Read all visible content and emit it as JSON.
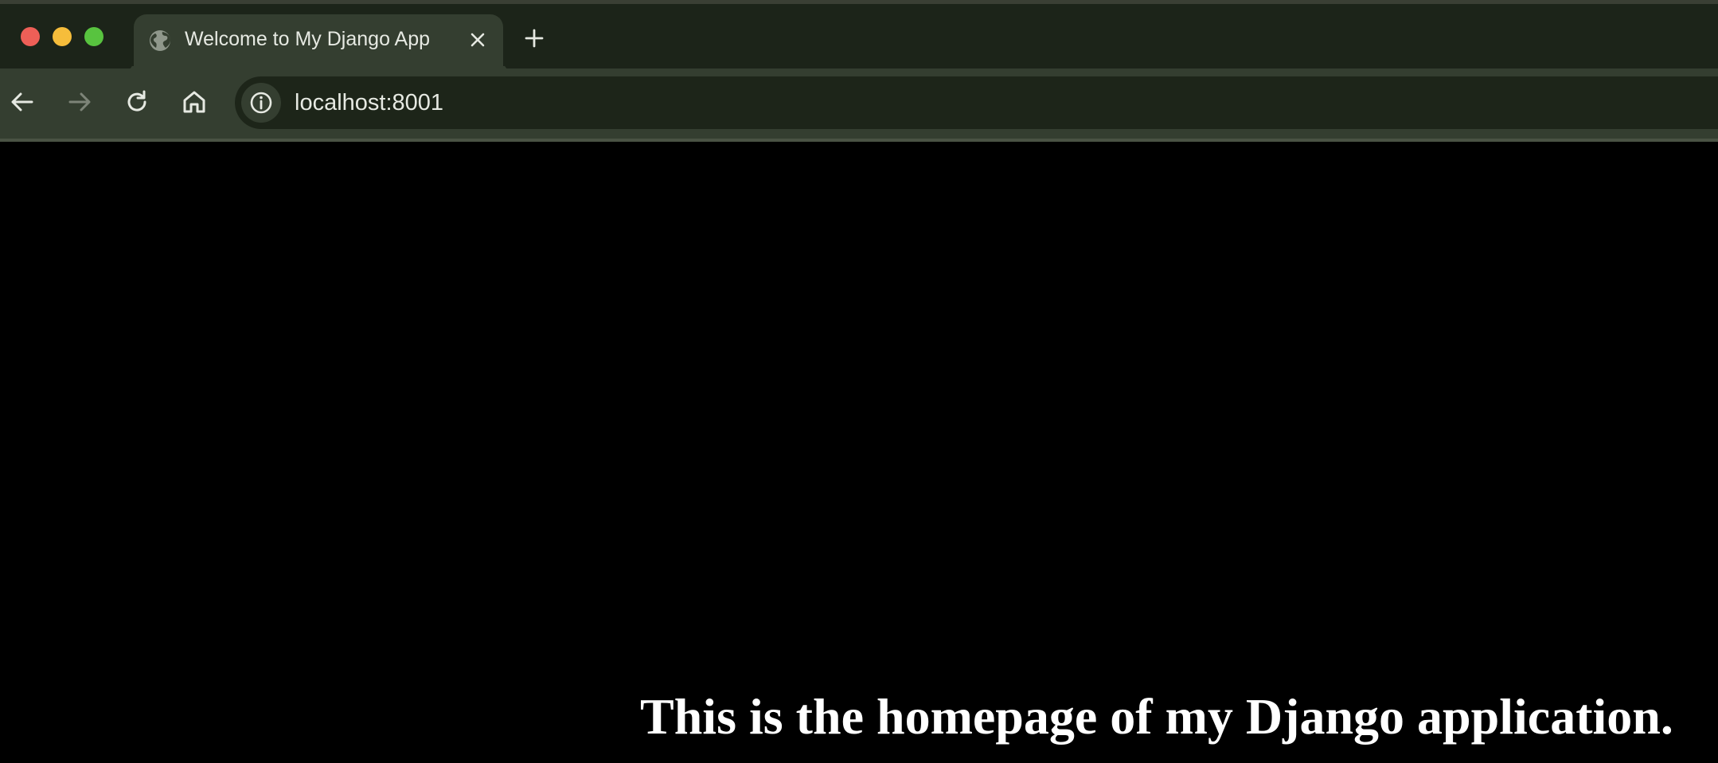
{
  "browser": {
    "tab": {
      "title": "Welcome to My Django App",
      "favicon": "globe-icon"
    },
    "address_bar": {
      "url": "localhost:8001",
      "site_info_icon": "info-icon"
    },
    "toolbar_icons": [
      "back-arrow-icon",
      "forward-arrow-icon",
      "reload-icon",
      "home-icon"
    ],
    "colors": {
      "tabstrip": "#1c2419",
      "toolbar": "#343e30",
      "omnibox": "#1d2519",
      "close": "#ee5f57",
      "minimize": "#f6bd3b",
      "maximize": "#58c33f"
    }
  },
  "page": {
    "heading": "This is the homepage of my Django application.",
    "background": "#000000"
  }
}
